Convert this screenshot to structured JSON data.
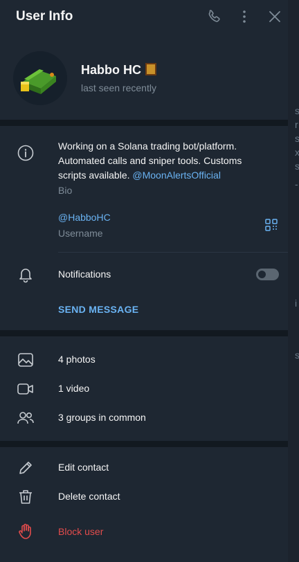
{
  "header": {
    "title": "User Info"
  },
  "profile": {
    "name": "Habbo HC",
    "last_seen": "last seen recently"
  },
  "bio": {
    "text": "Working on a Solana trading bot/platform. Automated calls and sniper tools. Customs scripts available. ",
    "mention": "@MoonAlertsOfficial",
    "label": "Bio"
  },
  "username": {
    "value": "@HabboHC",
    "label": "Username"
  },
  "notifications": {
    "label": "Notifications",
    "enabled": false
  },
  "send_message": "SEND MESSAGE",
  "media": {
    "photos": "4 photos",
    "videos": "1 video",
    "groups": "3 groups in common"
  },
  "actions": {
    "edit": "Edit contact",
    "delete": "Delete contact",
    "block": "Block user"
  },
  "colors": {
    "accent": "#6ab3f3",
    "danger": "#e34c4c",
    "background": "#1e2732"
  }
}
